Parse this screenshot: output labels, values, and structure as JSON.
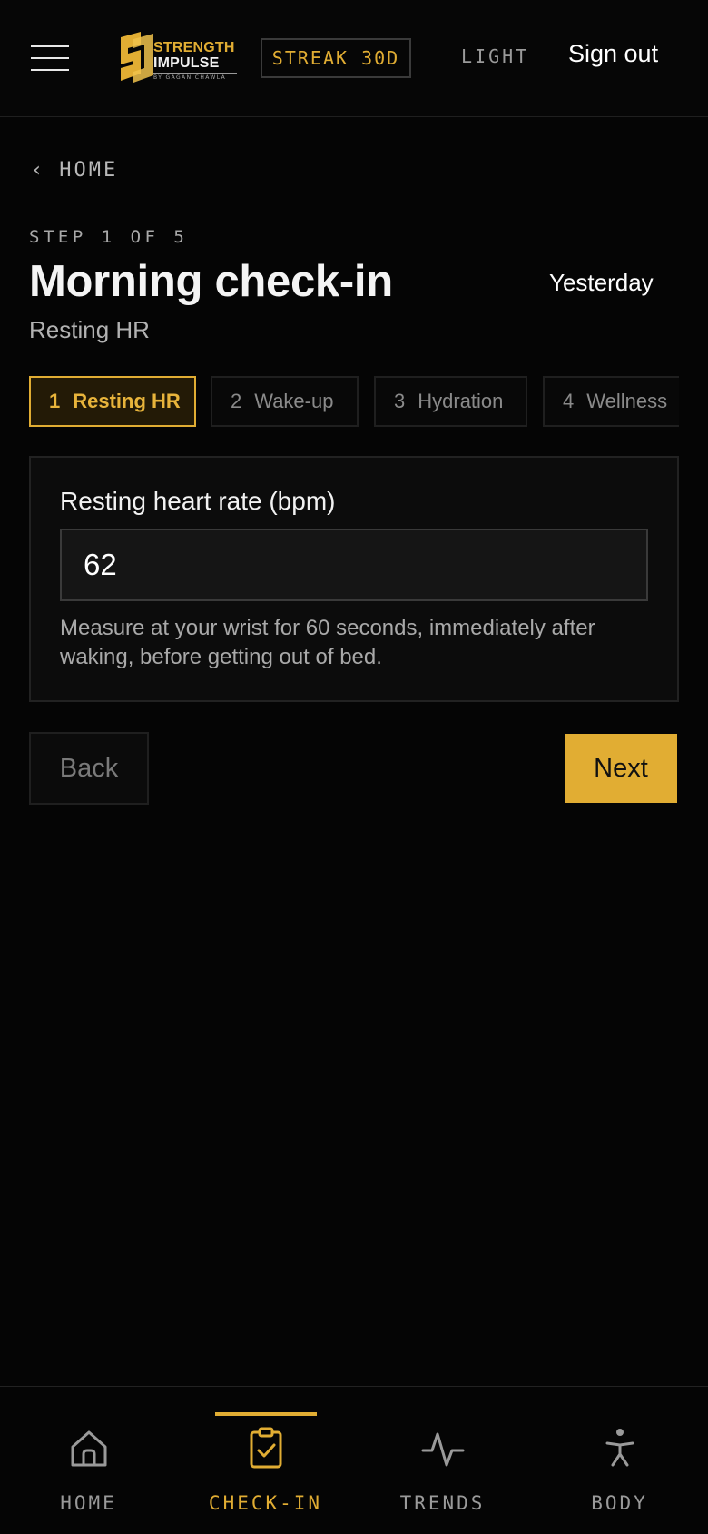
{
  "header": {
    "menu_icon": "hamburger-menu-icon",
    "logo": {
      "line1": "STRENGTH",
      "line2": "IMPULSE",
      "byline": "BY GAGAN CHAWLA"
    },
    "streak": "STREAK 30D",
    "theme_toggle": "LIGHT",
    "signout": "Sign out"
  },
  "breadcrumb": {
    "chevron": "‹",
    "label": "HOME"
  },
  "wizard": {
    "step_label": "STEP 1 OF 5",
    "title": "Morning check-in",
    "date": "Yesterday",
    "subtitle": "Resting HR",
    "tabs": [
      {
        "num": "1",
        "label": "Resting HR",
        "active": true
      },
      {
        "num": "2",
        "label": "Wake-up",
        "active": false
      },
      {
        "num": "3",
        "label": "Hydration",
        "active": false
      },
      {
        "num": "4",
        "label": "Wellness",
        "active": false
      }
    ]
  },
  "form": {
    "label": "Resting heart rate (bpm)",
    "value": "62",
    "help": "Measure at your wrist for 60 seconds, immediately after waking, before getting out of bed."
  },
  "actions": {
    "back": "Back",
    "next": "Next"
  },
  "bottom_nav": [
    {
      "label": "HOME",
      "icon": "home-icon",
      "active": false
    },
    {
      "label": "CHECK-IN",
      "icon": "clipboard-check-icon",
      "active": true
    },
    {
      "label": "TRENDS",
      "icon": "activity-pulse-icon",
      "active": false
    },
    {
      "label": "BODY",
      "icon": "person-icon",
      "active": false
    }
  ],
  "colors": {
    "accent": "#e1ad33",
    "background": "#050505"
  }
}
